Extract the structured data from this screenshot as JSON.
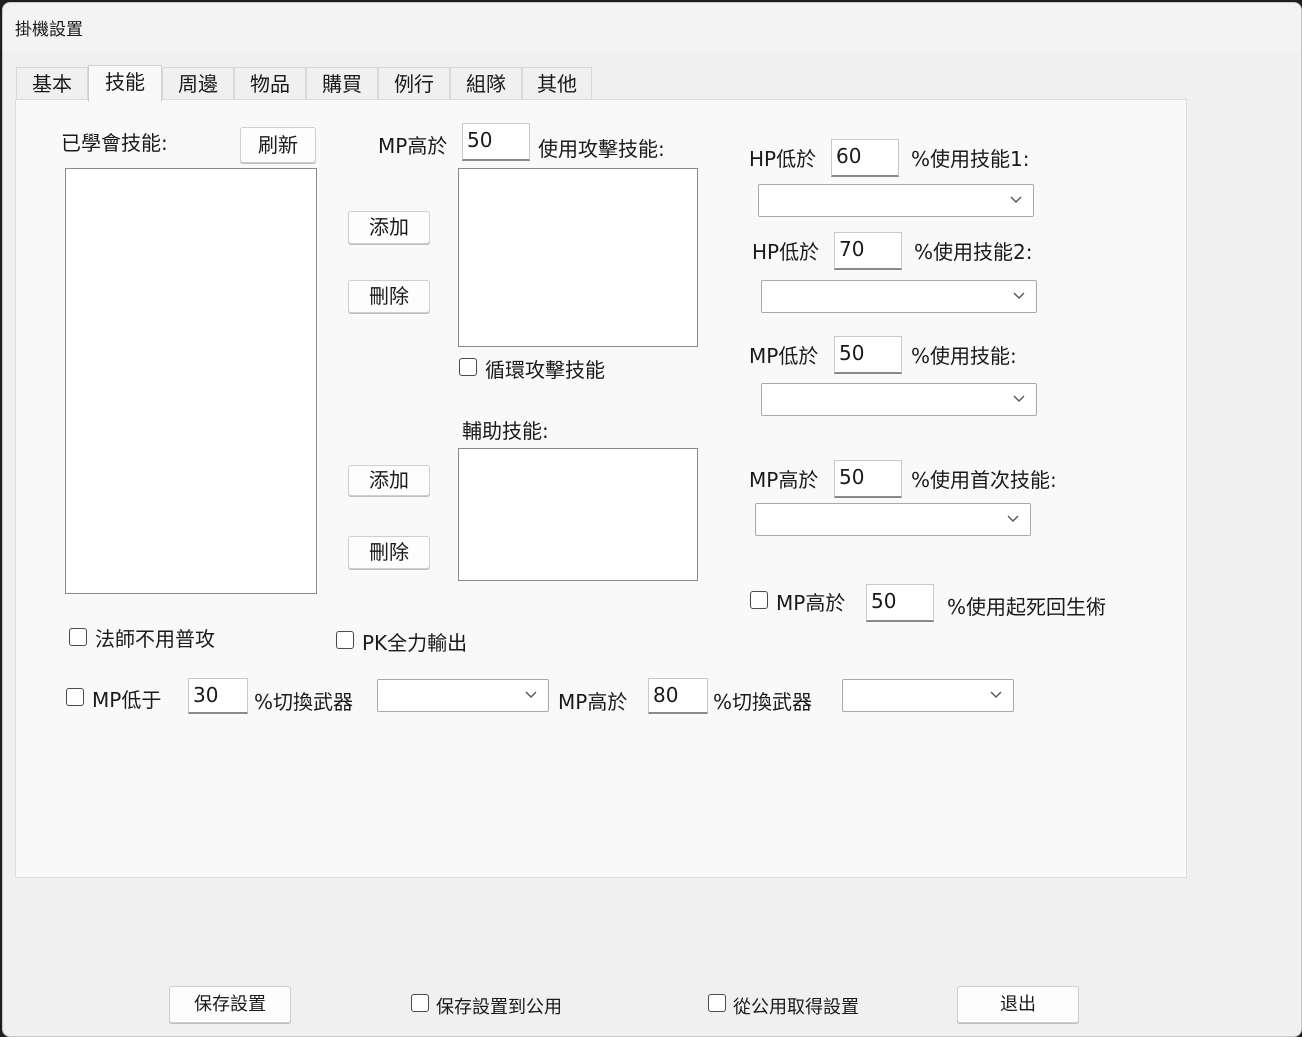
{
  "window": {
    "title": "掛機設置"
  },
  "tabs": [
    "基本",
    "技能",
    "周邊",
    "物品",
    "購買",
    "例行",
    "組隊",
    "其他"
  ],
  "skills": {
    "learned_label": "已學會技能:",
    "refresh_label": "刷新",
    "add_label": "添加",
    "delete_label": "刪除",
    "attack_mp_prefix": "MP高於",
    "attack_mp_value": "50",
    "attack_label": "使用攻擊技能:",
    "loop_attack_label": "循環攻擊技能",
    "assist_label": "輔助技能:"
  },
  "conditions": {
    "hp1_prefix": "HP低於",
    "hp1_value": "60",
    "hp1_suffix": "%使用技能1:",
    "hp2_prefix": "HP低於",
    "hp2_value": "70",
    "hp2_suffix": "%使用技能2:",
    "mp_low_prefix": "MP低於",
    "mp_low_value": "50",
    "mp_low_suffix": "%使用技能:",
    "mp_first_prefix": "MP高於",
    "mp_first_value": "50",
    "mp_first_suffix": "%使用首次技能:",
    "revive_prefix": "MP高於",
    "revive_value": "50",
    "revive_suffix": "%使用起死回生術"
  },
  "options": {
    "mage_no_normal_attack": "法師不用普攻",
    "pk_full_output": "PK全力輸出"
  },
  "weapon": {
    "low_prefix": "MP低于",
    "low_value": "30",
    "low_suffix": "%切換武器",
    "high_prefix": "MP高於",
    "high_value": "80",
    "high_suffix": "%切換武器"
  },
  "footer": {
    "save_label": "保存設置",
    "save_public_label": "保存設置到公用",
    "load_public_label": "從公用取得設置",
    "exit_label": "退出"
  },
  "colors": {
    "window_bg": "#f0f0f0",
    "panel_bg": "#f9f9f9"
  }
}
